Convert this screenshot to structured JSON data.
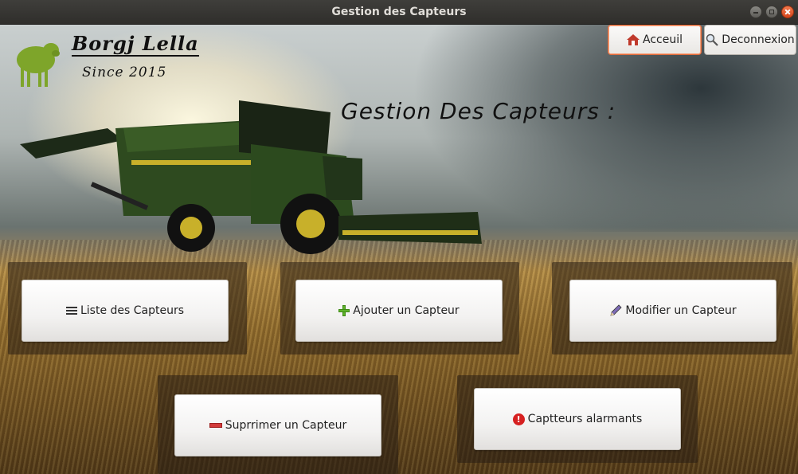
{
  "window": {
    "title": "Gestion des Capteurs"
  },
  "brand": {
    "name": "Borgj Lella",
    "since": "Since 2015"
  },
  "heading": "Gestion Des Capteurs :",
  "nav": {
    "home_label": "Acceuil",
    "logout_label": "Deconnexion"
  },
  "actions": {
    "list_label": "Liste des Capteurs",
    "add_label": "Ajouter un Capteur",
    "edit_label": "Modifier un Capteur",
    "delete_label": "Suprrimer un Capteur",
    "alarms_label": "Captteurs alarmants"
  },
  "icons": {
    "home": "home-icon",
    "logout": "search-icon",
    "list": "list-icon",
    "add": "plus-icon",
    "edit": "pencil-icon",
    "delete": "minus-icon",
    "alarms": "alert-icon"
  },
  "colors": {
    "accent": "#e46b3a",
    "sheep": "#7ea52a",
    "add": "#5fb32a",
    "delete": "#d23b3b",
    "alert": "#d62020"
  }
}
